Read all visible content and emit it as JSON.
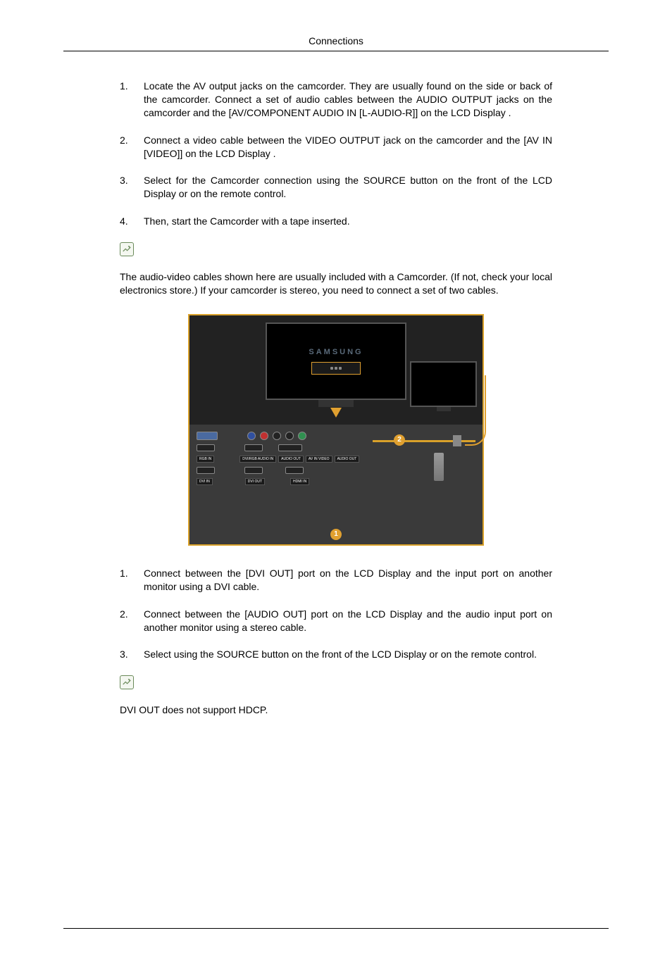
{
  "header": {
    "title": "Connections"
  },
  "section1": {
    "items": [
      {
        "num": "1.",
        "text": "Locate the AV output jacks on the camcorder. They are usually found on the side or back of the camcorder. Connect a set of audio cables between the AUDIO OUTPUT jacks on the camcorder and the [AV/COMPONENT AUDIO IN [L-AUDIO-R]] on the LCD Display ."
      },
      {
        "num": "2.",
        "text": "Connect a video cable between the VIDEO OUTPUT jack on the camcorder and the [AV IN [VIDEO]] on the LCD Display ."
      },
      {
        "num": "3.",
        "text": "Select      for the Camcorder connection using the SOURCE button on the front of the LCD Display or on the remote control."
      },
      {
        "num": "4.",
        "text": "Then, start the Camcorder with a tape inserted."
      }
    ],
    "note": "The audio-video cables shown here are usually included with a Camcorder. (If not, check your local electronics store.) If your camcorder is stereo, you need to connect a set of two cables."
  },
  "figure": {
    "brand": "SAMSUNG",
    "labels": {
      "rgb_in": "RGB IN",
      "dvi_in": "DVI IN",
      "dvi_rgb_audio": "DVI/RGB AUDIO IN",
      "dvi_out": "DVI OUT",
      "audio_out": "AUDIO OUT",
      "av_in": "AV IN VIDEO",
      "audio_out2": "AUDIO OUT",
      "hdmi_in": "HDMI IN"
    },
    "badge1": "1",
    "badge2": "2"
  },
  "section2": {
    "items": [
      {
        "num": "1.",
        "text": "Connect between the [DVI OUT] port on the LCD Display and the input port on another monitor using a DVI cable."
      },
      {
        "num": "2.",
        "text": "Connect between the [AUDIO OUT] port on the LCD Display and the audio input port on another monitor using a stereo cable."
      },
      {
        "num": "3.",
        "text": "Select       using the SOURCE button on the front of the LCD Display or on the remote control."
      }
    ],
    "note": "DVI OUT does not support HDCP."
  }
}
